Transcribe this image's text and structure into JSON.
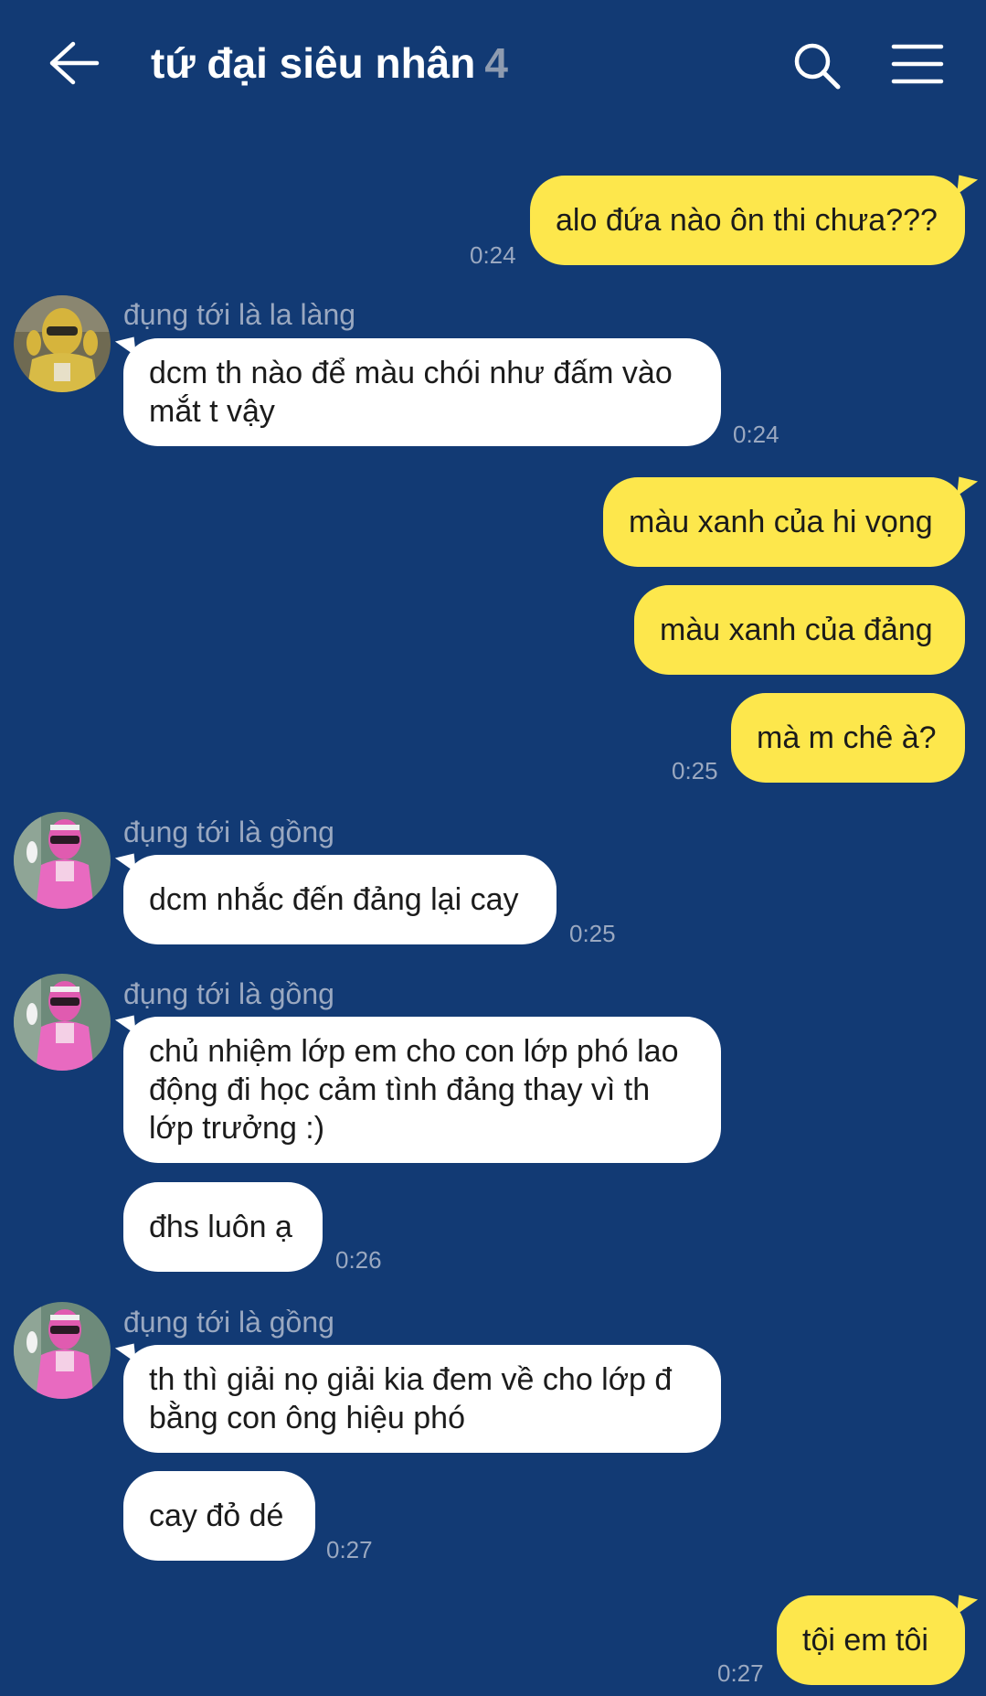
{
  "header": {
    "title": "tứ đại siêu nhân",
    "member_count": "4",
    "back_icon": "arrow-left-icon",
    "search_icon": "search-icon",
    "menu_icon": "hamburger-menu-icon"
  },
  "colors": {
    "background": "#123a74",
    "outgoing_bubble": "#fde74c",
    "incoming_bubble": "#ffffff",
    "secondary_text": "#9aa8c0"
  },
  "messages": [
    {
      "text": "alo đứa nào ôn thi chưa???",
      "time": "0:24"
    },
    {
      "sender": "đụng tới là la làng",
      "line1": "dcm th nào để màu chói như đấm vào",
      "line2": "mắt t vậy",
      "time": "0:24"
    },
    {
      "text": "màu xanh của hi vọng"
    },
    {
      "text": "màu xanh của đảng"
    },
    {
      "text": "mà m chê à?",
      "time": "0:25"
    },
    {
      "sender": "đụng tới là gồng",
      "text": "dcm nhắc đến đảng lại cay",
      "time": "0:25"
    },
    {
      "sender": "đụng tới là gồng",
      "line1": "chủ nhiệm lớp em cho con lớp phó lao",
      "line2": "động đi học cảm tình đảng thay vì th",
      "line3": "lớp trưởng :)"
    },
    {
      "text": "đhs luôn ạ",
      "time": "0:26"
    },
    {
      "sender": "đụng tới là gồng",
      "line1": "th thì giải nọ giải kia đem về cho lớp đ",
      "line2": "bằng con ông hiệu phó"
    },
    {
      "text": "cay đỏ dé",
      "time": "0:27"
    },
    {
      "text": "tội em tôi",
      "time": "0:27"
    }
  ]
}
